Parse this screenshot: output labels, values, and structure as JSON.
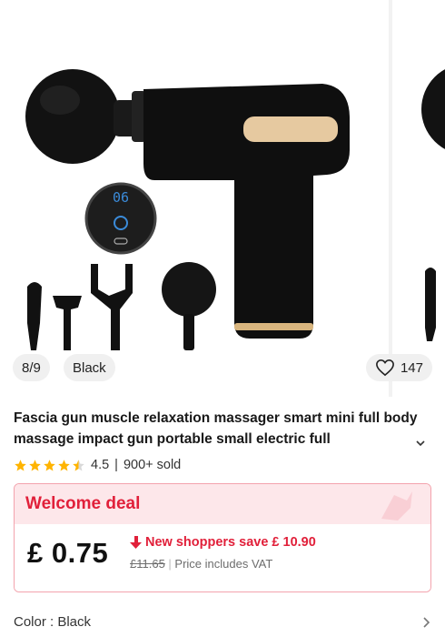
{
  "gallery": {
    "index_label": "8/9",
    "color_label": "Black",
    "favorites_count": "147",
    "screen_digits": "06"
  },
  "product": {
    "title": "Fascia gun muscle relaxation massager smart mini full body massage impact gun portable small electric full",
    "rating_value": "4.5",
    "rating_stars": 4.5,
    "separator": "|",
    "sold": "900+ sold"
  },
  "deal": {
    "title": "Welcome deal",
    "price": "£ 0.75",
    "save_text": "New shoppers save  £ 10.90",
    "original_price": "£11.65",
    "vat_text": "Price includes VAT"
  },
  "color_row": {
    "label": "Color : Black"
  },
  "colors": {
    "deal_red": "#e1203a",
    "deal_bg": "#fde7ea",
    "star": "#ffb400",
    "accent_gold": "#e6c9a0"
  }
}
